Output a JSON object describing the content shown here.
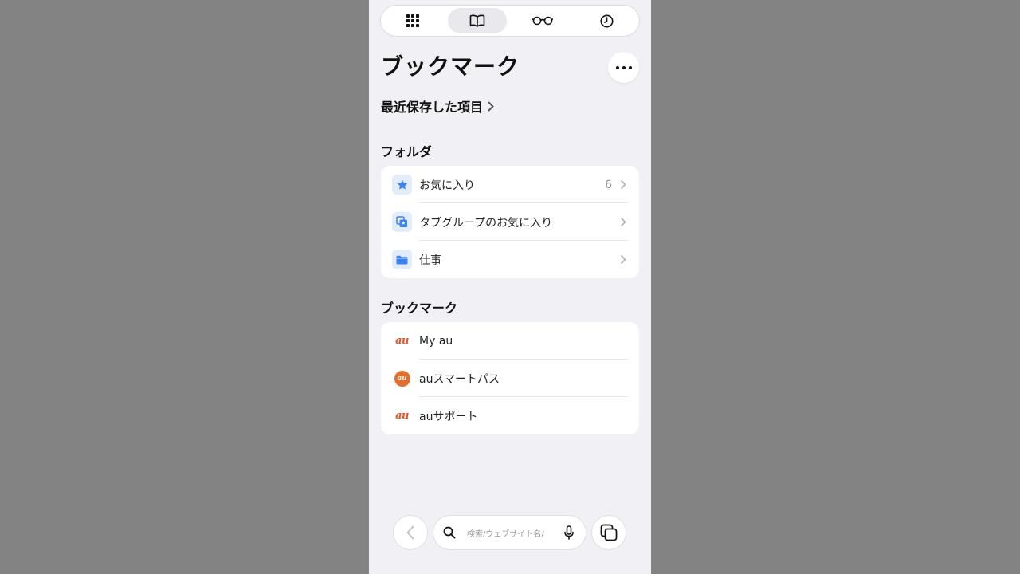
{
  "colors": {
    "background_outer": "#838383",
    "panel": "#f0f0f5",
    "accent_blue": "#3b82f6",
    "au_orange": "#e8531d"
  },
  "top_tabs": [
    {
      "icon": "apps-grid-icon",
      "active": false
    },
    {
      "icon": "bookmarks-book-icon",
      "active": true
    },
    {
      "icon": "reading-list-glasses-icon",
      "active": false
    },
    {
      "icon": "history-clock-icon",
      "active": false
    }
  ],
  "header": {
    "title": "ブックマーク",
    "more_icon": "more-dots-icon"
  },
  "recent": {
    "label": "最近保存した項目"
  },
  "folders": {
    "heading": "フォルダ",
    "items": [
      {
        "label": "お気に入り",
        "count": "6",
        "icon": "star-icon"
      },
      {
        "label": "タブグループのお気に入り",
        "count": "",
        "icon": "tab-group-star-icon"
      },
      {
        "label": "仕事",
        "count": "",
        "icon": "folder-icon"
      }
    ]
  },
  "bookmarks": {
    "heading": "ブックマーク",
    "items": [
      {
        "label": "My au",
        "icon": "au-logo-icon",
        "logo_text": "au"
      },
      {
        "label": "auスマートパス",
        "icon": "au-smartpass-icon",
        "logo_text": "au"
      },
      {
        "label": "auサポート",
        "icon": "au-logo-icon",
        "logo_text": "au"
      }
    ]
  },
  "bottom_bar": {
    "search_placeholder": "検索/ウェブサイト名/",
    "back_icon": "back-chevron-icon",
    "search_icon": "search-icon",
    "mic_icon": "microphone-icon",
    "tabs_icon": "tabs-overview-icon"
  }
}
